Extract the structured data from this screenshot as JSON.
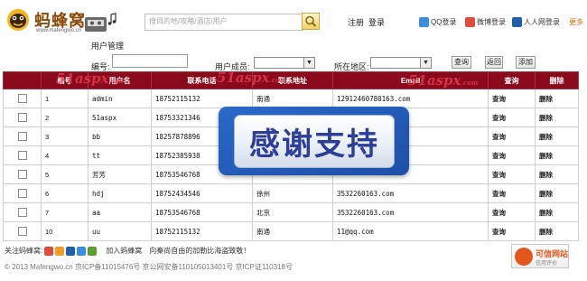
{
  "header": {
    "logo_text": "蚂蜂窝",
    "logo_url": "www.mafengwo.cn",
    "search_placeholder": "搜目的地/攻略/酒店/用户",
    "register": "注册",
    "login": "登录",
    "social": [
      {
        "label": "QQ登录",
        "icon": "qq-icon",
        "color": "#3a8de0"
      },
      {
        "label": "微博登录",
        "icon": "weibo-icon",
        "color": "#e34a3b"
      },
      {
        "label": "人人网登录",
        "icon": "renren-icon",
        "color": "#1f5fb0"
      }
    ],
    "more": "更多"
  },
  "page_title": "用户管理",
  "filter": {
    "id_label": "编号:",
    "member_label": "用户成员:",
    "region_label": "所在地区:",
    "buttons": {
      "query": "查询",
      "back": "返回",
      "add": "添加"
    }
  },
  "table": {
    "columns": [
      "",
      "编号",
      "用户名",
      "联系电话",
      "联系地址",
      "Email",
      "查询",
      "删除"
    ],
    "rows": [
      {
        "id": "1",
        "name": "admin",
        "phone": "18752115132",
        "addr": "南通",
        "email": "12912460780163.com"
      },
      {
        "id": "2",
        "name": "51aspx",
        "phone": "18753321346",
        "addr": "",
        "email": ""
      },
      {
        "id": "3",
        "name": "bb",
        "phone": "18257878896",
        "addr": "",
        "email": ""
      },
      {
        "id": "4",
        "name": "tt",
        "phone": "18752385938",
        "addr": "",
        "email": ""
      },
      {
        "id": "5",
        "name": "芳芳",
        "phone": "18753546768",
        "addr": "",
        "email": ""
      },
      {
        "id": "6",
        "name": "hdj",
        "phone": "18752434546",
        "addr": "徐州",
        "email": "3532260163.com"
      },
      {
        "id": "7",
        "name": "aa",
        "phone": "18753546768",
        "addr": "北京",
        "email": "3532260163.com"
      },
      {
        "id": "10",
        "name": "uu",
        "phone": "18752115132",
        "addr": "南通",
        "email": "11@qq.com"
      }
    ],
    "action_query": "查询",
    "action_delete": "删除"
  },
  "watermark": {
    "text": "51aspx",
    "suffix": ".com"
  },
  "overlay": {
    "text": "感谢支持"
  },
  "footer": {
    "follow_label": "关注蚂蜂窝:",
    "join_link": "加入蚂蜂窝",
    "slogan": "向秦尚自由的加勒比海盗致敬！",
    "copyright": "© 2013 Mafengwo.cn 京ICP备11015476号 京公网安备110105013401号 京ICP证110318号",
    "badge_title": "可信网站",
    "badge_sub": "信用评价"
  },
  "colors": {
    "table_header": "#8a0a1c",
    "accent": "#d66a00",
    "overlay": "#1d4fa8"
  }
}
